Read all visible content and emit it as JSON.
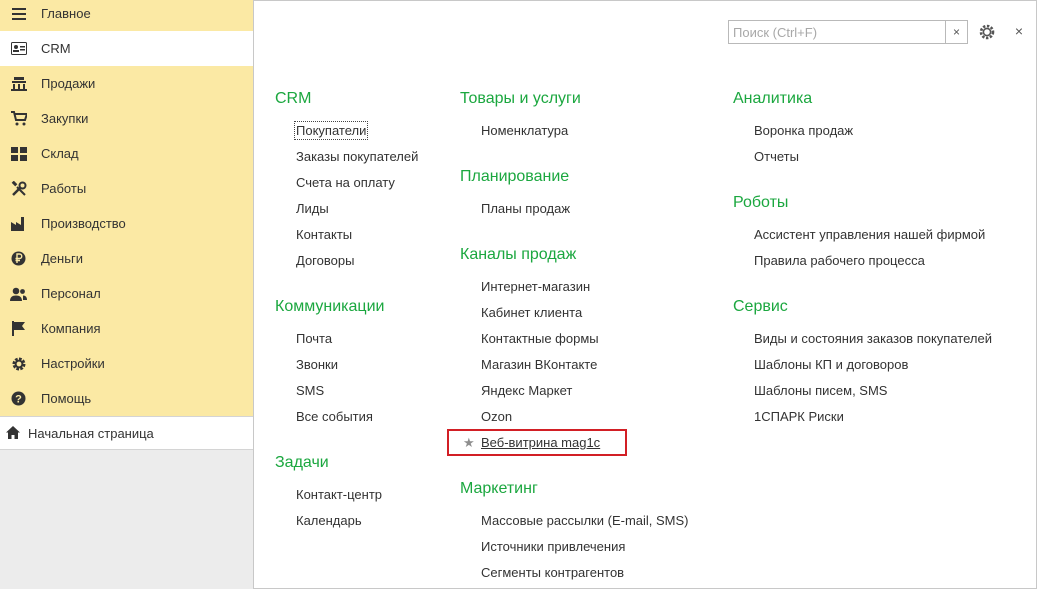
{
  "sidebar": {
    "items": [
      {
        "label": "Главное",
        "icon": "menu-icon"
      },
      {
        "label": "CRM",
        "icon": "contact-card-icon"
      },
      {
        "label": "Продажи",
        "icon": "cash-register-icon"
      },
      {
        "label": "Закупки",
        "icon": "cart-icon"
      },
      {
        "label": "Склад",
        "icon": "warehouse-icon"
      },
      {
        "label": "Работы",
        "icon": "tools-icon"
      },
      {
        "label": "Производство",
        "icon": "factory-icon"
      },
      {
        "label": "Деньги",
        "icon": "ruble-icon"
      },
      {
        "label": "Персонал",
        "icon": "people-icon"
      },
      {
        "label": "Компания",
        "icon": "flag-icon"
      },
      {
        "label": "Настройки",
        "icon": "gear-icon"
      },
      {
        "label": "Помощь",
        "icon": "help-icon"
      }
    ],
    "home": {
      "label": "Начальная страница",
      "icon": "home-icon"
    }
  },
  "toolbar": {
    "search_placeholder": "Поиск (Ctrl+F)",
    "clear_label": "×",
    "close_label": "×"
  },
  "colors": {
    "accent": "#1ba73f",
    "sidebar_bg": "#fbe9a4",
    "highlight": "#d21f25"
  },
  "sections": {
    "crm": {
      "title": "CRM",
      "links": [
        "Покупатели",
        "Заказы покупателей",
        "Счета на оплату",
        "Лиды",
        "Контакты",
        "Договоры"
      ]
    },
    "communications": {
      "title": "Коммуникации",
      "links": [
        "Почта",
        "Звонки",
        "SMS",
        "Все события"
      ]
    },
    "tasks": {
      "title": "Задачи",
      "links": [
        "Контакт-центр",
        "Календарь"
      ]
    },
    "goods": {
      "title": "Товары и услуги",
      "links": [
        "Номенклатура"
      ]
    },
    "planning": {
      "title": "Планирование",
      "links": [
        "Планы продаж"
      ]
    },
    "channels": {
      "title": "Каналы продаж",
      "links": [
        "Интернет-магазин",
        "Кабинет клиента",
        "Контактные формы",
        "Магазин ВКонтакте",
        "Яндекс Маркет",
        "Ozon",
        "Веб-витрина mag1c"
      ]
    },
    "marketing": {
      "title": "Маркетинг",
      "links": [
        "Массовые рассылки (E-mail, SMS)",
        "Источники привлечения",
        "Сегменты контрагентов"
      ]
    },
    "analytics": {
      "title": "Аналитика",
      "links": [
        "Воронка продаж",
        "Отчеты"
      ]
    },
    "robots": {
      "title": "Роботы",
      "links": [
        "Ассистент управления нашей фирмой",
        "Правила рабочего процесса"
      ]
    },
    "service": {
      "title": "Сервис",
      "links": [
        "Виды и состояния заказов покупателей",
        "Шаблоны КП и договоров",
        "Шаблоны писем, SMS",
        "1СПАРК Риски"
      ]
    }
  }
}
